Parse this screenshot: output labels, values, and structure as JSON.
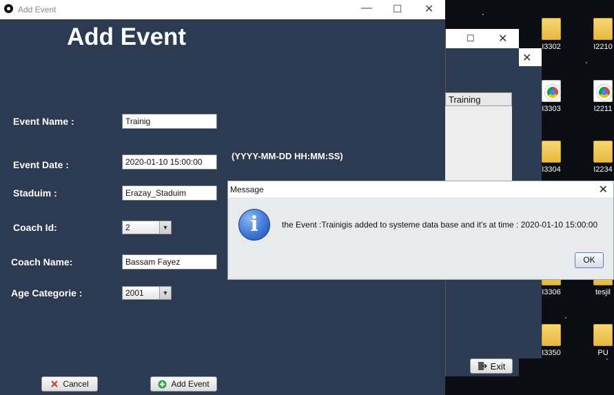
{
  "window": {
    "title": "Add Event",
    "heading": "Add Event"
  },
  "form": {
    "event_name": {
      "label": "Event Name :",
      "value": "Trainig"
    },
    "event_date": {
      "label": "Event Date :",
      "value": "2020-01-10 15:00:00",
      "hint": "(YYYY-MM-DD HH:MM:SS)"
    },
    "stadium": {
      "label": "Staduim :",
      "value": "Erazay_Staduim"
    },
    "coach_id": {
      "label": "Coach Id:",
      "value": "2"
    },
    "coach_name": {
      "label": "Coach Name:",
      "value": "Bassam Fayez"
    },
    "age_category": {
      "label": "Age Categorie :",
      "value": "2001"
    }
  },
  "buttons": {
    "cancel": "Cancel",
    "add_event": "Add Event"
  },
  "dialog": {
    "title": "Message",
    "message": "the Event :Trainigis added to systeme data base and it's at time : 2020-01-10 15:00:00",
    "ok": "OK"
  },
  "background_window": {
    "column_header": "Training",
    "exit": "Exit"
  },
  "desktop_icons": [
    "I3302",
    "I2210",
    "I3303",
    "I2211",
    "I3304",
    "I2234",
    "I3306",
    "tesjil",
    "I3350",
    "PU"
  ],
  "colors": {
    "window_bg": "#2c3a52",
    "dialog_bg": "#e9eaec",
    "info_icon": "#3f78d6"
  },
  "icons": {
    "app": "soccer-ball-icon",
    "info": "info-icon",
    "cancel": "x-icon",
    "add": "plus-circle-icon",
    "exit": "exit-door-icon"
  }
}
